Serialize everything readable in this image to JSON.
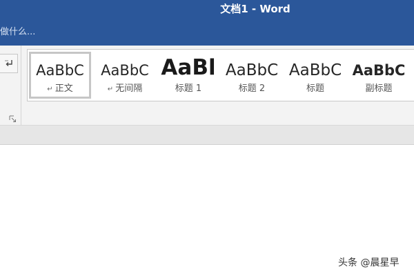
{
  "window": {
    "title": "文档1 - Word"
  },
  "tell_me": {
    "text": "做什么..."
  },
  "styles_gallery": {
    "items": [
      {
        "preview": "AaBbC",
        "label": "正文",
        "has_para_mark": true,
        "selected": true
      },
      {
        "preview": "AaBbC",
        "label": "无间隔",
        "has_para_mark": true,
        "selected": false
      },
      {
        "preview": "AaBl",
        "label": "标题 1",
        "has_para_mark": false,
        "selected": false
      },
      {
        "preview": "AaBbC",
        "label": "标题 2",
        "has_para_mark": false,
        "selected": false
      },
      {
        "preview": "AaBbC",
        "label": "标题",
        "has_para_mark": false,
        "selected": false
      },
      {
        "preview": "AaBbC",
        "label": "副标题",
        "has_para_mark": false,
        "selected": false
      }
    ],
    "para_mark_glyph": "↵"
  },
  "watermark": {
    "text": "头条 @晨星早"
  },
  "colors": {
    "title_bar": "#2b579a",
    "ribbon_bg": "#f3f3f3",
    "document_bg": "#ffffff"
  }
}
